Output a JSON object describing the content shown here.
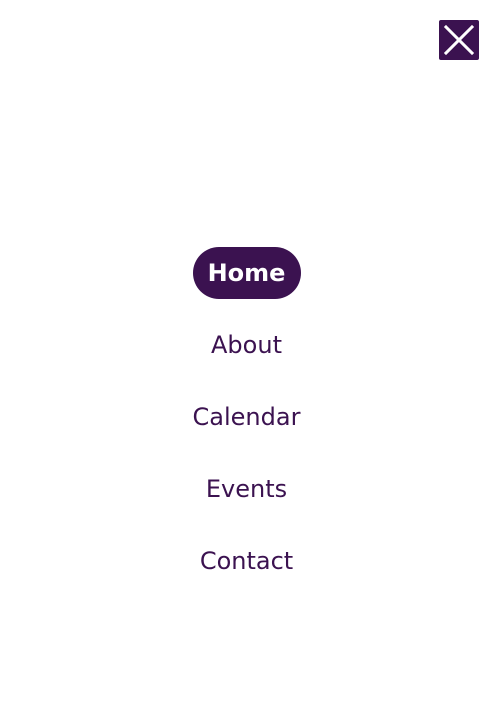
{
  "close_button": {
    "icon": "close-icon"
  },
  "nav": {
    "items": [
      {
        "label": "Home",
        "active": true
      },
      {
        "label": "About",
        "active": false
      },
      {
        "label": "Calendar",
        "active": false
      },
      {
        "label": "Events",
        "active": false
      },
      {
        "label": "Contact",
        "active": false
      }
    ]
  },
  "colors": {
    "brand": "#3b1250",
    "background": "#ffffff",
    "active_text": "#ffffff"
  }
}
